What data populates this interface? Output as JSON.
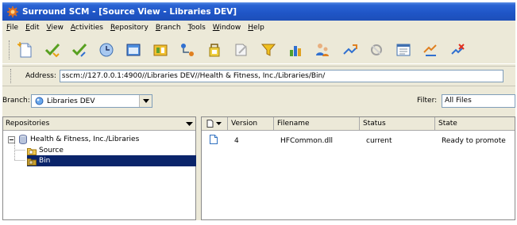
{
  "window": {
    "title": "Surround SCM - [Source View - Libraries DEV]"
  },
  "menu": [
    {
      "accel": "F",
      "rest": "ile"
    },
    {
      "accel": "E",
      "rest": "dit"
    },
    {
      "accel": "V",
      "rest": "iew"
    },
    {
      "accel": "A",
      "rest": "ctivities"
    },
    {
      "accel": "R",
      "rest": "epository"
    },
    {
      "accel": "B",
      "rest": "ranch"
    },
    {
      "accel": "T",
      "rest": "ools"
    },
    {
      "accel": "W",
      "rest": "indow"
    },
    {
      "accel": "H",
      "rest": "elp"
    }
  ],
  "toolbar_icons": [
    "add-files-icon",
    "check-in-icon",
    "check-out-icon",
    "history-icon",
    "view-icon",
    "compare-icon",
    "workflow-icon",
    "label-icon",
    "edit-icon",
    "filter-icon",
    "reports-icon",
    "users-icon",
    "promote-icon",
    "rebase-icon",
    "properties-icon",
    "duplicate-icon",
    "remove-icon"
  ],
  "address": {
    "label": "Address:",
    "value": "sscm://127.0.0.1:4900//Libraries DEV//Health & Fitness, Inc./Libraries/Bin/"
  },
  "branch": {
    "label": "Branch:",
    "value": "Libraries DEV"
  },
  "filter": {
    "label": "Filter:",
    "value": "All Files"
  },
  "repositories": {
    "header": "Repositories",
    "root": "Health & Fitness, Inc./Libraries",
    "children": [
      "Source",
      "Bin"
    ],
    "selected": "Bin"
  },
  "files": {
    "columns": [
      "Version",
      "Filename",
      "Status",
      "State"
    ],
    "rows": [
      {
        "version": "4",
        "filename": "HFCommon.dll",
        "status": "current",
        "state": "Ready to promote"
      }
    ]
  },
  "colors": {
    "titlebar": "#1f55c6",
    "selection": "#0a246a",
    "chrome": "#ece9d8"
  }
}
